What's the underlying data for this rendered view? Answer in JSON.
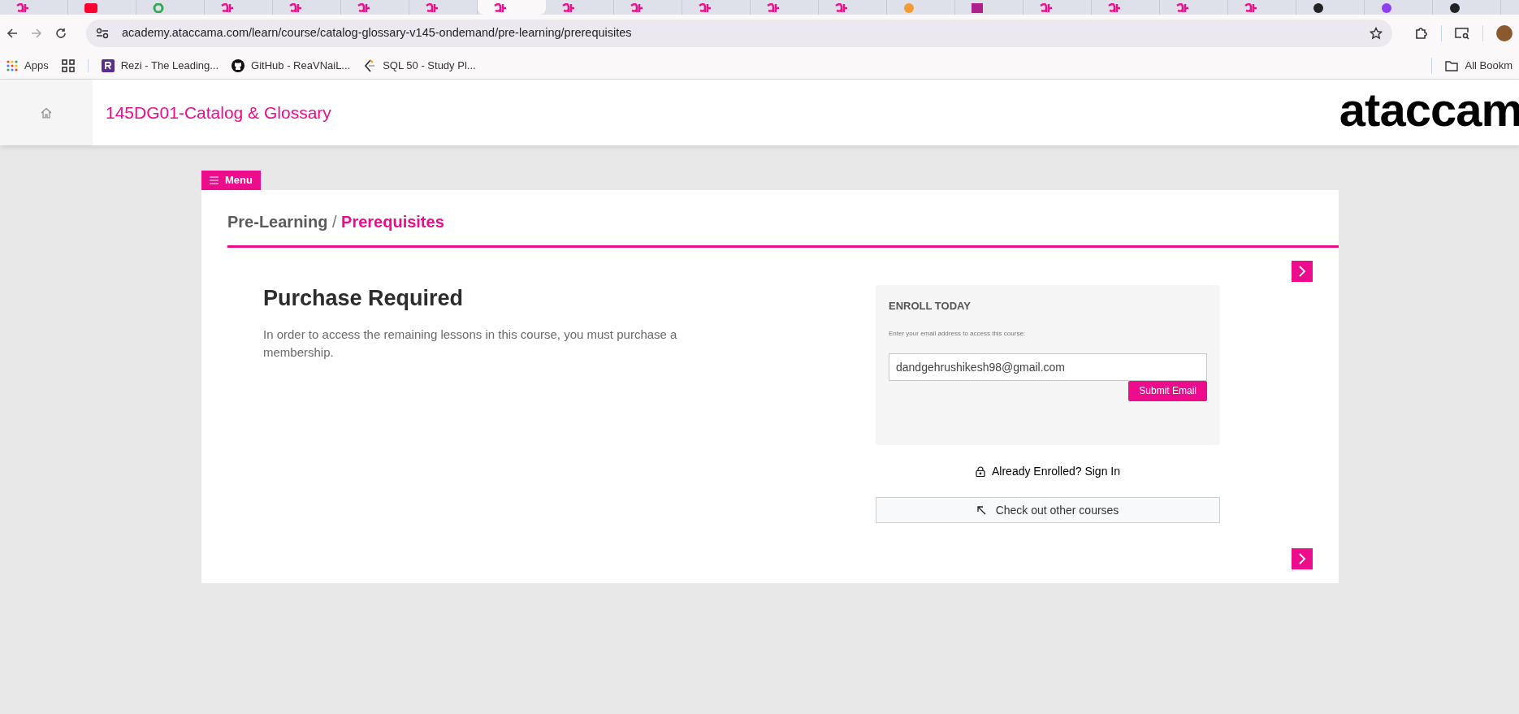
{
  "browser": {
    "tabs": [
      {
        "kind": "brand",
        "selected": false
      },
      {
        "kind": "video",
        "selected": false
      },
      {
        "kind": "ring",
        "selected": false
      },
      {
        "kind": "brand",
        "selected": false
      },
      {
        "kind": "brand",
        "selected": false
      },
      {
        "kind": "brand",
        "selected": false
      },
      {
        "kind": "brand",
        "selected": false
      },
      {
        "kind": "brand",
        "selected": true
      },
      {
        "kind": "brand",
        "selected": false
      },
      {
        "kind": "brand",
        "selected": false
      },
      {
        "kind": "brand",
        "selected": false
      },
      {
        "kind": "brand",
        "selected": false
      },
      {
        "kind": "brand",
        "selected": false
      },
      {
        "kind": "orange",
        "selected": false
      },
      {
        "kind": "square",
        "selected": false
      },
      {
        "kind": "brand",
        "selected": false
      },
      {
        "kind": "brand",
        "selected": false
      },
      {
        "kind": "brand",
        "selected": false
      },
      {
        "kind": "brand",
        "selected": false
      },
      {
        "kind": "dark",
        "selected": false
      },
      {
        "kind": "purple",
        "selected": false
      },
      {
        "kind": "dark",
        "selected": false
      }
    ],
    "url": "academy.ataccama.com/learn/course/catalog-glossary-v145-ondemand/pre-learning/prerequisites",
    "bookmarks": [
      {
        "kind": "apps",
        "label": "Apps"
      },
      {
        "kind": "grid"
      },
      {
        "kind": "letter",
        "label": "Rezi - The Leading..."
      },
      {
        "kind": "github",
        "label": "GitHub - ReaVNaiL..."
      },
      {
        "kind": "code",
        "label": "SQL 50 - Study Pl..."
      }
    ],
    "all_bookmarks": "All Bookm"
  },
  "header": {
    "course_title": "145DG01-Catalog & Glossary",
    "logo": "ataccam"
  },
  "menu_button": "Menu",
  "breadcrumb": {
    "parent": "Pre-Learning",
    "separator": "/",
    "current": "Prerequisites"
  },
  "lesson": {
    "heading": "Purchase Required",
    "text": "In order to access the remaining lessons in this course, you must purchase a membership."
  },
  "enroll": {
    "title": "ENROLL TODAY",
    "hint": "Enter your email address to access this course:",
    "email": "dandgehrushikesh98@gmail.com",
    "submit": "Submit Email"
  },
  "sign_in": "Already Enrolled? Sign In",
  "other_courses": "Check out other courses"
}
